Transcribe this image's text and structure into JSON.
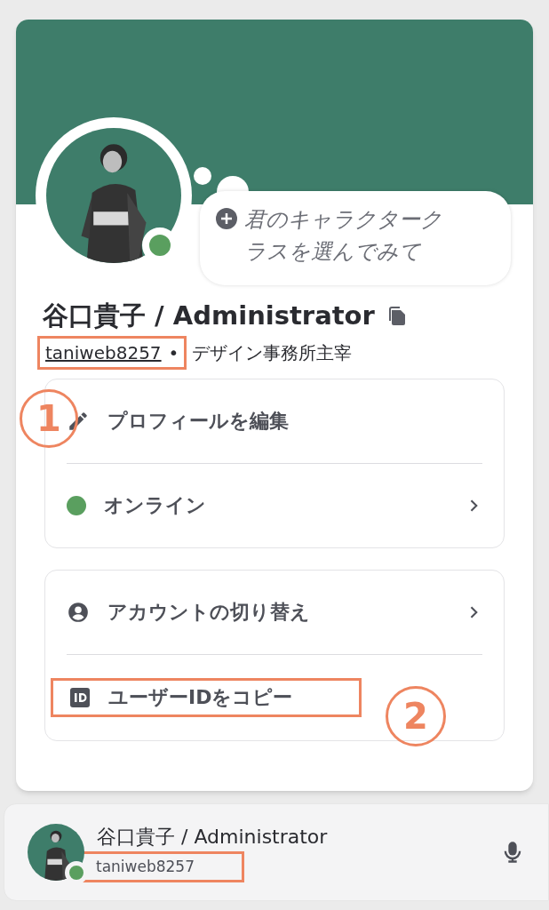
{
  "profile": {
    "online": true,
    "custom_status": "君のキャラクタークラスを選んでみて",
    "display_name": "谷口貴子 / Administrator",
    "username": "taniweb8257",
    "separator": "•",
    "bio": "デザイン事務所主宰"
  },
  "menu_groups": [
    {
      "items": [
        {
          "kind": "edit",
          "label": "プロフィールを編集",
          "submenu": false,
          "highlighted": false
        },
        {
          "kind": "status",
          "label": "オンライン",
          "color": "#5a9f5f",
          "submenu": true,
          "highlighted": false
        }
      ]
    },
    {
      "items": [
        {
          "kind": "account",
          "label": "アカウントの切り替え",
          "submenu": true,
          "highlighted": false
        },
        {
          "kind": "id",
          "label": "ユーザーIDをコピー",
          "submenu": false,
          "highlighted": true
        }
      ]
    }
  ],
  "annotations": [
    {
      "label": "1"
    },
    {
      "label": "2"
    }
  ],
  "user_bar": {
    "display_name": "谷口貴子 / Administrator",
    "username": "taniweb8257",
    "online": true,
    "username_highlighted": true
  }
}
